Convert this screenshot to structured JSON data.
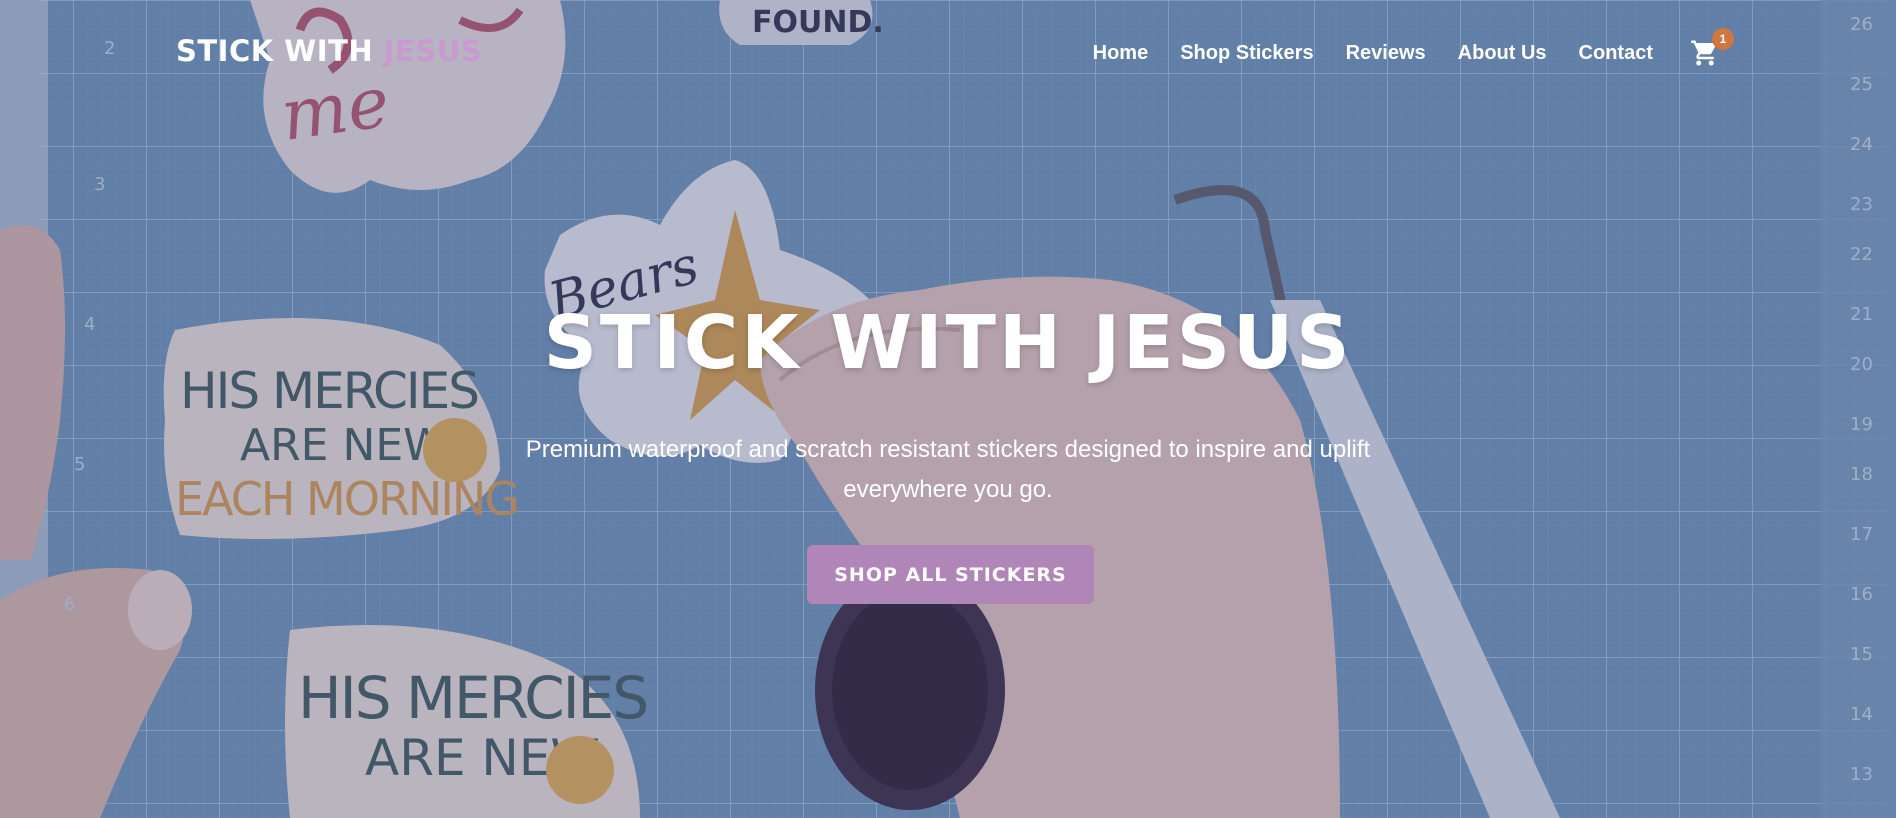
{
  "header": {
    "logo_part1": "STICK WITH ",
    "logo_part2": "JESUS",
    "nav": [
      {
        "label": "Home"
      },
      {
        "label": "Shop Stickers"
      },
      {
        "label": "Reviews"
      },
      {
        "label": "About Us"
      },
      {
        "label": "Contact"
      }
    ],
    "cart": {
      "icon": "cart-icon",
      "count": "1"
    }
  },
  "hero": {
    "title": "STICK WITH JESUS",
    "subtitle": "Premium waterproof and scratch resistant stickers designed to inspire and uplift everywhere you go.",
    "cta_label": "SHOP ALL STICKERS"
  },
  "background": {
    "sticker_text_1": "HIS MERCIES",
    "sticker_text_2": "ARE NEW",
    "sticker_text_3": "EACH MORNING",
    "sticker_top_1": "Jesus loves me",
    "sticker_top_2": "FOUND."
  },
  "colors": {
    "accent": "#c89ad0",
    "button": "#b085b7",
    "badge": "#d0763f"
  }
}
